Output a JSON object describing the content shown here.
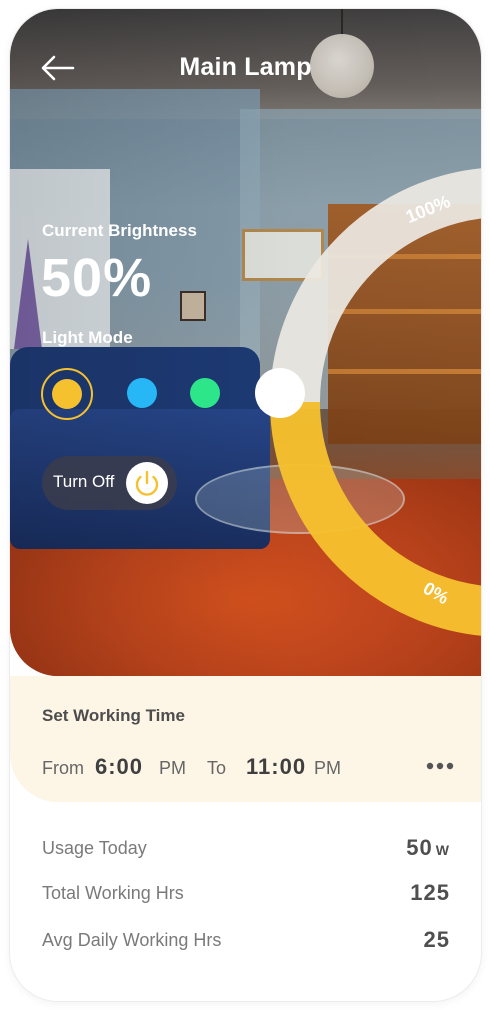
{
  "header": {
    "title": "Main Lamp",
    "back_icon": "arrow-left-icon"
  },
  "brightness": {
    "label": "Current Brightness",
    "value": "50%",
    "level_percent": 50,
    "dial_max_label": "100%",
    "dial_min_label": "0%"
  },
  "light_mode": {
    "label": "Light Mode",
    "options": [
      {
        "name": "warm-yellow",
        "color": "#f6c12e",
        "selected": true
      },
      {
        "name": "sky-blue",
        "color": "#27b7f7",
        "selected": false
      },
      {
        "name": "mint-green",
        "color": "#2ee68a",
        "selected": false
      }
    ]
  },
  "power": {
    "label": "Turn Off",
    "icon": "power-icon"
  },
  "working_time": {
    "title": "Set Working Time",
    "from_label": "From",
    "from_time": "6:00",
    "from_ampm": "PM",
    "to_label": "To",
    "to_time": "11:00",
    "to_ampm": "PM",
    "more_icon": "more-horizontal-icon"
  },
  "stats": [
    {
      "label": "Usage Today",
      "value": "50",
      "unit": "W"
    },
    {
      "label": "Total Working Hrs",
      "value": "125",
      "unit": ""
    },
    {
      "label": "Avg Daily Working Hrs",
      "value": "25",
      "unit": ""
    }
  ],
  "colors": {
    "accent": "#f6c12e",
    "card_bg": "#fdf6e7",
    "dial_track": "#ece8e2"
  }
}
